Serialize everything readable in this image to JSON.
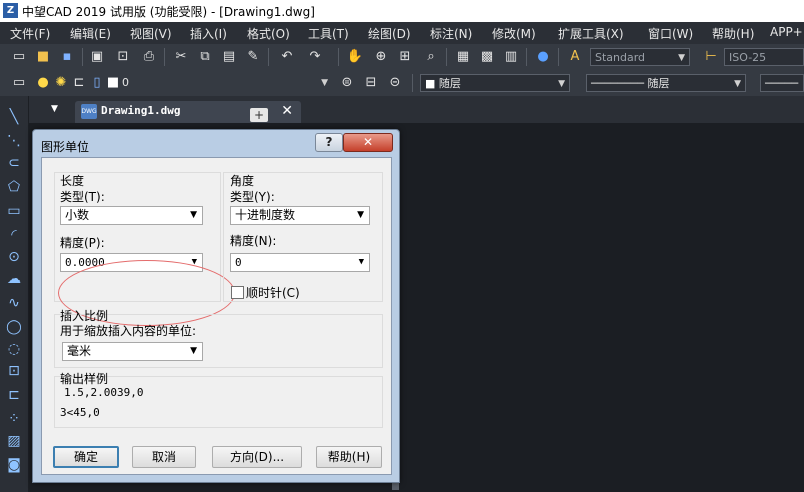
{
  "window": {
    "app_icon": "Z",
    "title": "中望CAD 2019 试用版 (功能受限) - [Drawing1.dwg]"
  },
  "menubar": {
    "items": [
      "文件(F)",
      "编辑(E)",
      "视图(V)",
      "插入(I)",
      "格式(O)",
      "工具(T)",
      "绘图(D)",
      "标注(N)",
      "修改(M)",
      "扩展工具(X)",
      "窗口(W)",
      "帮助(H)",
      "APP+"
    ]
  },
  "toolbar": {
    "text_style": "Standard",
    "dim_style": "ISO-25",
    "layer_current": "0",
    "color": "随层",
    "linetype": "随层"
  },
  "tabs": {
    "document": "Drawing1.dwg",
    "dwg_icon_label": "DWG",
    "close_glyph": "✕",
    "new_tab_glyph": "+"
  },
  "dialog": {
    "title": "图形单位",
    "help_glyph": "?",
    "close_glyph": "✕",
    "length": {
      "group_label": "长度",
      "type_label": "类型(T):",
      "type_value": "小数",
      "precision_label": "精度(P):",
      "precision_value": "0.0000"
    },
    "angle": {
      "group_label": "角度",
      "type_label": "类型(Y):",
      "type_value": "十进制度数",
      "precision_label": "精度(N):",
      "precision_value": "0",
      "clockwise_label": "顺时针(C)",
      "clockwise_checked": false
    },
    "insert_scale": {
      "group_label": "插入比例",
      "description": "用于缩放插入内容的单位:",
      "unit_value": "毫米"
    },
    "sample": {
      "group_label": "输出样例",
      "line1": "1.5,2.0039,0",
      "line2": "3<45,0"
    },
    "buttons": {
      "ok": "确定",
      "cancel": "取消",
      "direction": "方向(D)...",
      "help": "帮助(H)"
    }
  }
}
